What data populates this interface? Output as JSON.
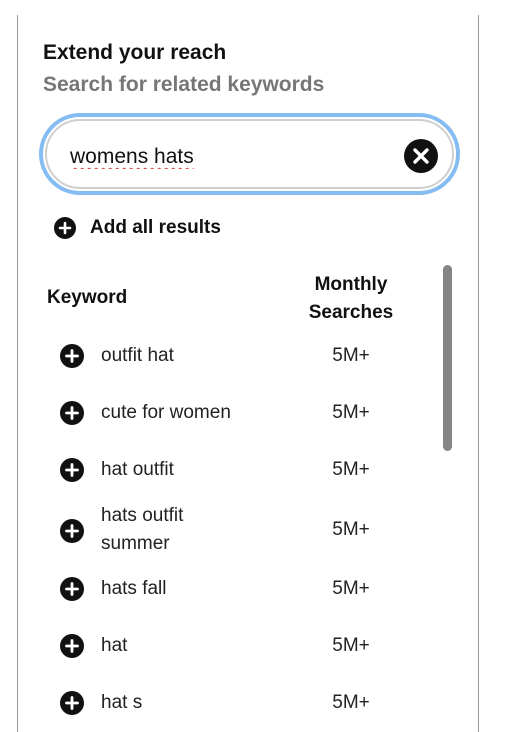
{
  "header": {
    "title": "Extend your reach",
    "subtitle": "Search for related keywords"
  },
  "search": {
    "value": "womens hats",
    "clear_icon": "close-icon"
  },
  "add_all": {
    "label": "Add all results",
    "icon": "plus-circle-icon"
  },
  "table": {
    "columns": {
      "keyword": "Keyword",
      "monthly_searches": "Monthly Searches"
    },
    "rows": [
      {
        "keyword": "outfit hat",
        "searches": "5M+"
      },
      {
        "keyword": "cute for women",
        "searches": "5M+"
      },
      {
        "keyword": "hat outfit",
        "searches": "5M+"
      },
      {
        "keyword": "hats outfit summer",
        "searches": "5M+"
      },
      {
        "keyword": "hats fall",
        "searches": "5M+"
      },
      {
        "keyword": "hat",
        "searches": "5M+"
      },
      {
        "keyword": "hat s",
        "searches": "5M+"
      }
    ]
  },
  "colors": {
    "focus_ring": "#85bdf2",
    "subtitle": "#767676",
    "icon": "#111111",
    "scrollbar": "#858585"
  }
}
